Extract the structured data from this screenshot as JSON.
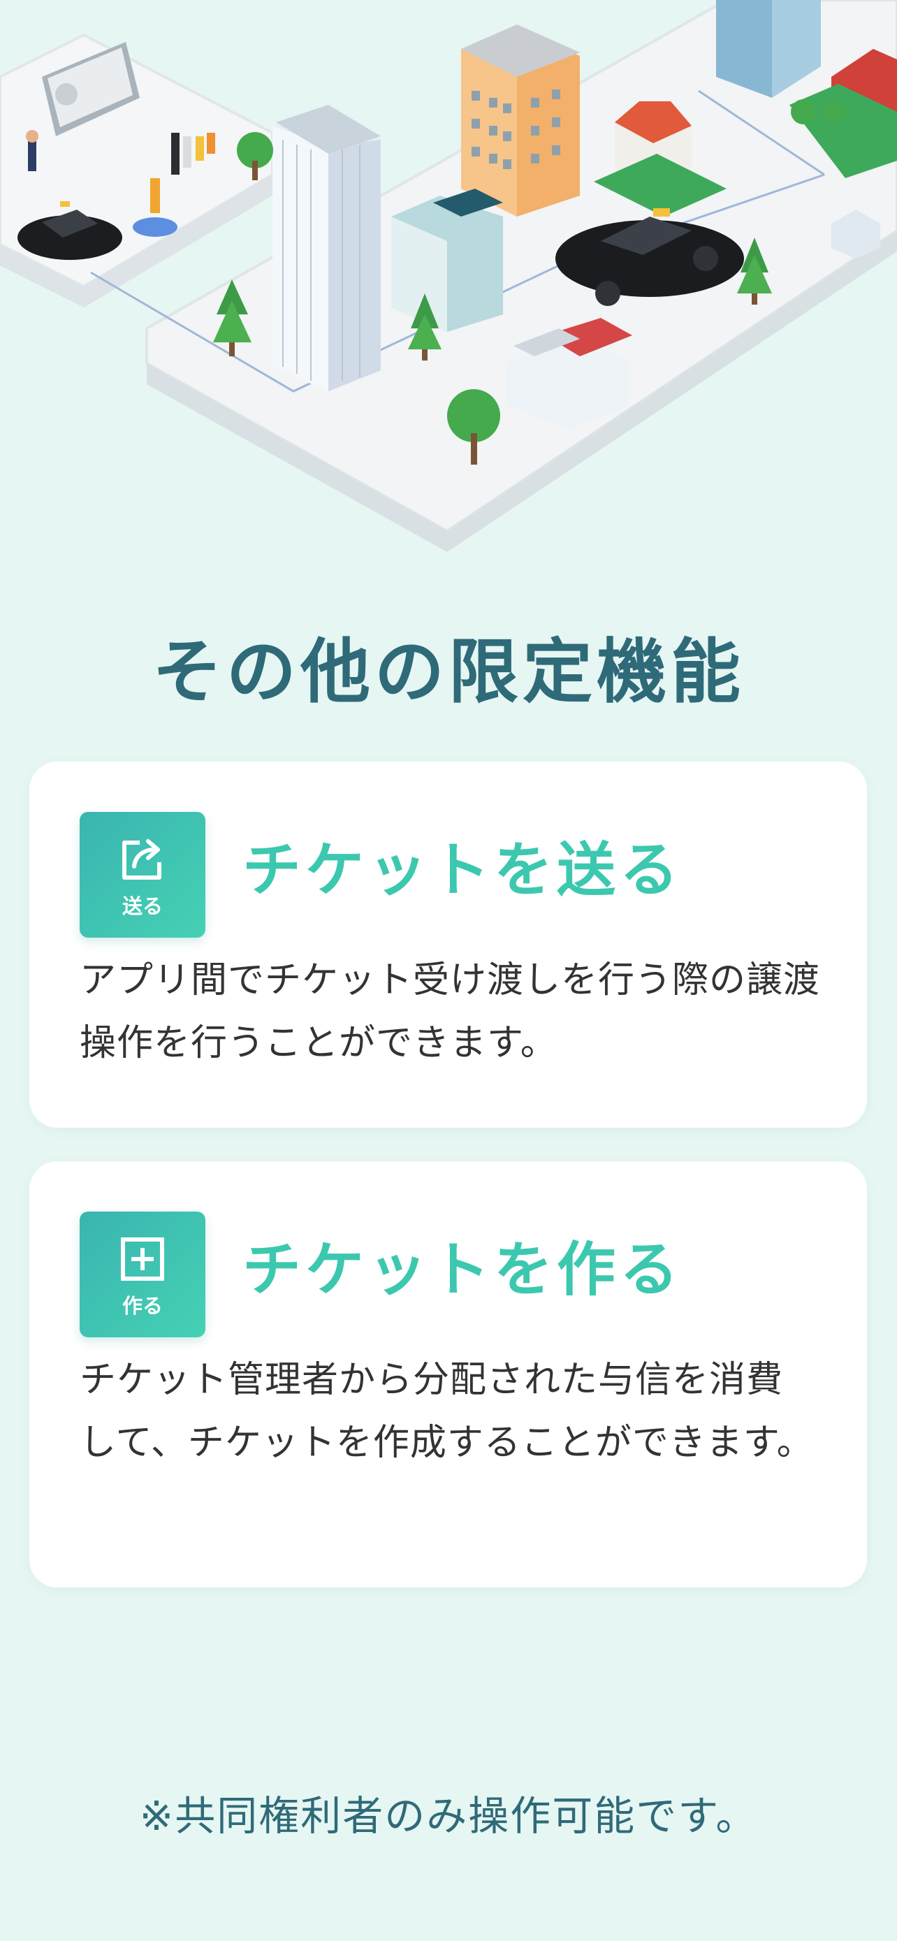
{
  "section": {
    "title": "その他の限定機能"
  },
  "features": [
    {
      "badge_label": "送る",
      "icon": "share-icon",
      "title": "チケットを送る",
      "description": "アプリ間でチケット受け渡しを行う際の譲渡操作を行うことができます。"
    },
    {
      "badge_label": "作る",
      "icon": "plus-square-icon",
      "title": "チケットを作る",
      "description": "チケット管理者から分配された与信を消費して、チケットを作成することができます。"
    }
  ],
  "footer": {
    "note": "※共同権利者のみ操作可能です。"
  },
  "colors": {
    "background": "#e6f6f3",
    "heading": "#2f6a78",
    "accent": "#3cc8ae",
    "badge_gradient_start": "#3ab5b0",
    "badge_gradient_end": "#45d1b4"
  }
}
